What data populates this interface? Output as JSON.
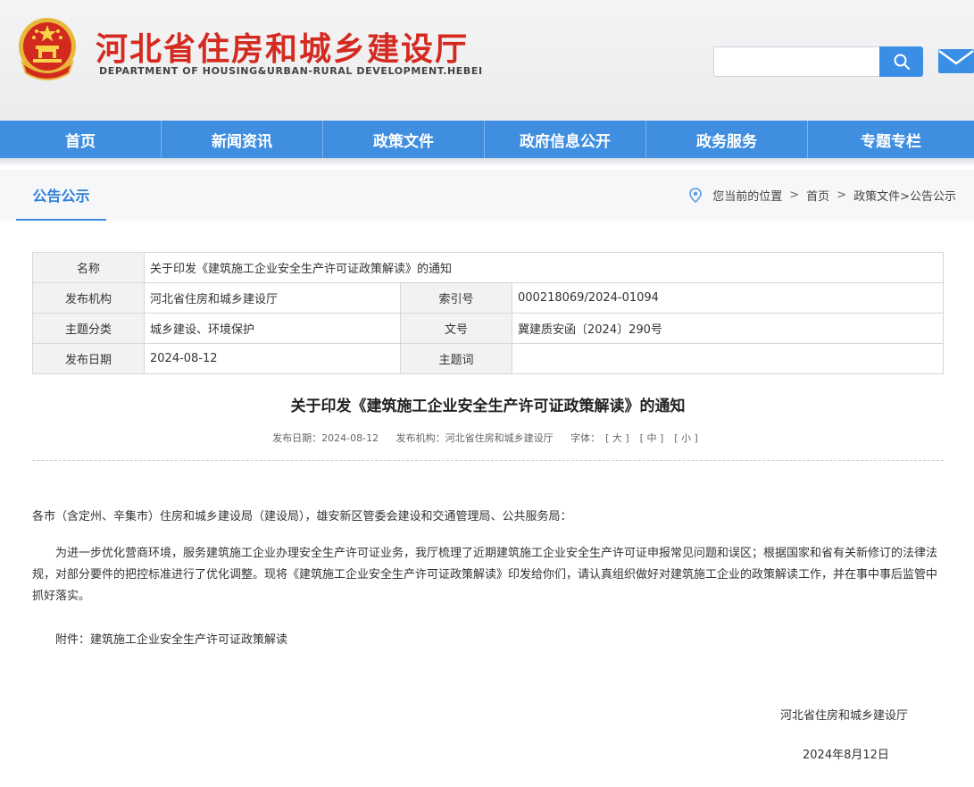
{
  "header": {
    "title": "河北省住房和城乡建设厅",
    "subtitle": "DEPARTMENT OF HOUSING&URBAN-RURAL DEVELOPMENT.HEBEI",
    "emblem_icon": "national-emblem-icon",
    "search": {
      "value": "",
      "placeholder": ""
    },
    "search_icon": "search-icon",
    "mail_icon": "mail-icon",
    "title_color": "#d42a20",
    "accent_color": "#3b8ee5"
  },
  "nav": {
    "items": [
      "首页",
      "新闻资讯",
      "政策文件",
      "政府信息公开",
      "政务服务",
      "专题专栏"
    ]
  },
  "section": {
    "title": "公告公示",
    "breadcrumb": {
      "prefix": "您当前的位置",
      "sep": ">",
      "home": "首页",
      "current": "政策文件>公告公示"
    }
  },
  "meta": {
    "name_label": "名称",
    "name_value": "关于印发《建筑施工企业安全生产许可证政策解读》的通知",
    "issuer_label": "发布机构",
    "issuer_value": "河北省住房和城乡建设厅",
    "index_label": "索引号",
    "index_value": "000218069/2024-01094",
    "topic_label": "主题分类",
    "topic_value": "城乡建设、环境保护",
    "docno_label": "文号",
    "docno_value": "冀建质安函〔2024〕290号",
    "date_label": "发布日期",
    "date_value": "2024-08-12",
    "keyword_label": "主题词",
    "keyword_value": ""
  },
  "article": {
    "title": "关于印发《建筑施工企业安全生产许可证政策解读》的通知",
    "pub_date": "发布日期：2024-08-12",
    "pub_org": "发布机构：河北省住房和城乡建设厅",
    "font_label": "字体：",
    "font_large": "[ 大 ]",
    "font_medium": "[ 中 ]",
    "font_small": "[ 小 ]",
    "salutation": "各市（含定州、辛集市）住房和城乡建设局（建设局），雄安新区管委会建设和交通管理局、公共服务局：",
    "paragraph": "为进一步优化营商环境，服务建筑施工企业办理安全生产许可证业务，我厅梳理了近期建筑施工企业安全生产许可证申报常见问题和误区；根据国家和省有关新修订的法律法规，对部分要件的把控标准进行了优化调整。现将《建筑施工企业安全生产许可证政策解读》印发给你们，请认真组织做好对建筑施工企业的政策解读工作，并在事中事后监管中抓好落实。",
    "attachment": "附件：建筑施工企业安全生产许可证政策解读",
    "signature": "河北省住房和城乡建设厅",
    "date": "2024年8月12日"
  }
}
